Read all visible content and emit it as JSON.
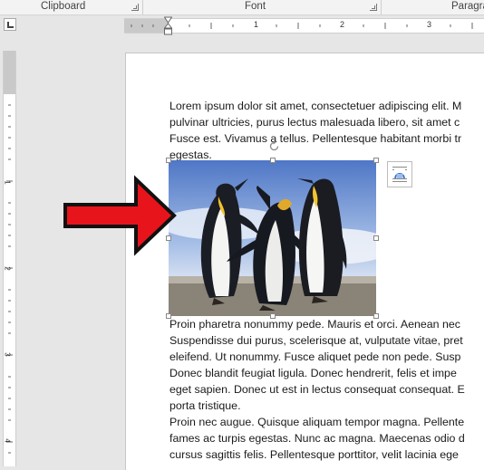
{
  "ribbon": {
    "groups": [
      {
        "label": "Clipboard"
      },
      {
        "label": "Font"
      },
      {
        "label": "Paragra"
      }
    ]
  },
  "ruler": {
    "horizontal_numbers": [
      "1",
      "2",
      "3"
    ],
    "vertical_numbers": [
      "1",
      "2",
      "3",
      "4"
    ]
  },
  "document": {
    "paragraph1": [
      "Lorem ipsum dolor sit amet, consectetuer adipiscing elit. M",
      "pulvinar ultricies, purus lectus malesuada libero, sit amet c",
      "Fusce est. Vivamus a tellus. Pellentesque habitant morbi tr",
      "egestas."
    ],
    "paragraph2": [
      "Proin pharetra nonummy pede. Mauris et orci. Aenean nec",
      "Suspendisse dui purus, scelerisque at, vulputate vitae, pret",
      "eleifend. Ut nonummy. Fusce aliquet pede non pede. Susp",
      "Donec blandit feugiat ligula. Donec hendrerit, felis et impe",
      "eget sapien. Donec ut est in lectus consequat consequat. E",
      "porta tristique."
    ],
    "paragraph3": [
      "Proin nec augue. Quisque aliquam tempor magna. Pellente",
      "fames ac turpis egestas. Nunc ac magna. Maecenas odio d",
      "cursus sagittis felis. Pellentesque porttitor, velit lacinia ege"
    ]
  },
  "picture": {
    "subject": "penguins photo",
    "selected": true
  },
  "icons": {
    "layout_options": "layout-options-icon",
    "rotate": "rotate-handle-icon",
    "arrow": "red-arrow-icon"
  },
  "colors": {
    "arrow_fill": "#e8141b",
    "arrow_outline": "#111111",
    "ribbon_bg": "#f3f3f3",
    "workspace_bg": "#e6e6e6"
  }
}
